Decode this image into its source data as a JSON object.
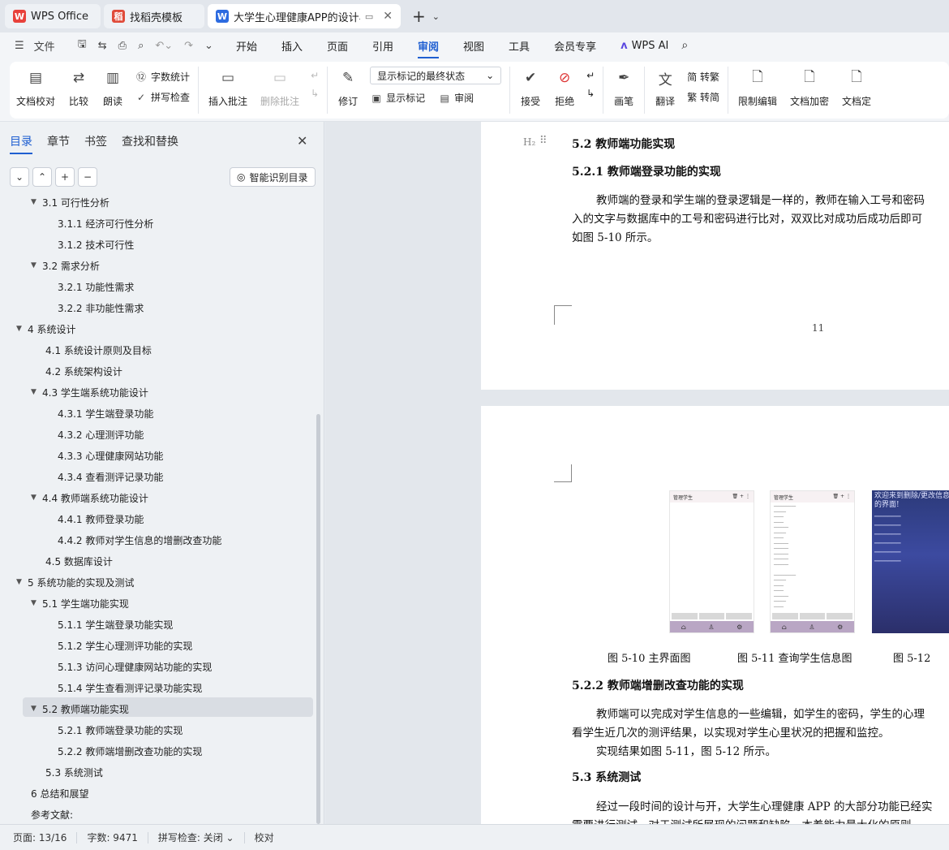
{
  "tabs": [
    {
      "label": "WPS Office",
      "logo": "W",
      "color": "#e8413b",
      "state": "inactive"
    },
    {
      "label": "找稻壳模板",
      "logo": "稻",
      "color": "#e04b3a",
      "state": "inactive"
    },
    {
      "label": "大学生心理健康APP的设计与实",
      "logo": "W",
      "color": "#2d6be0",
      "state": "active"
    }
  ],
  "menubar": {
    "file": "文件",
    "items": [
      "开始",
      "插入",
      "页面",
      "引用",
      "审阅",
      "视图",
      "工具",
      "会员专享"
    ],
    "active": "审阅",
    "wps_ai": "WPS AI"
  },
  "ribbon": {
    "doc_proofread": "文档校对",
    "compare": "比较",
    "read_aloud": "朗读",
    "word_count": "字数统计",
    "spell_check": "拼写检查",
    "insert_comment": "插入批注",
    "delete_comment": "删除批注",
    "revise": "修订",
    "markup_display": "显示标记的最终状态",
    "show_markup": "显示标记",
    "review": "审阅",
    "accept": "接受",
    "reject": "拒绝",
    "pen": "画笔",
    "translate": "翻译",
    "to_traditional": "简 转繁",
    "to_simplified": "繁 转简",
    "restrict_edit": "限制编辑",
    "encrypt": "文档加密",
    "finalize": "文档定"
  },
  "panel": {
    "tabs": [
      "目录",
      "章节",
      "书签",
      "查找和替换"
    ],
    "active_tab": "目录",
    "smart_toc": "智能识别目录",
    "toc": [
      {
        "label": "3.1 可行性分析",
        "level": 2,
        "arrow": "▼"
      },
      {
        "label": "3.1.1 经济可行性分析",
        "level": 3,
        "arrow": ""
      },
      {
        "label": "3.1.2 技术可行性",
        "level": 3,
        "arrow": ""
      },
      {
        "label": "3.2 需求分析",
        "level": 2,
        "arrow": "▼"
      },
      {
        "label": "3.2.1 功能性需求",
        "level": 3,
        "arrow": ""
      },
      {
        "label": "3.2.2  非功能性需求",
        "level": 3,
        "arrow": ""
      },
      {
        "label": "4 系统设计",
        "level": 1,
        "arrow": "▼"
      },
      {
        "label": "4.1 系统设计原则及目标",
        "level": 2,
        "arrow": ""
      },
      {
        "label": "4.2  系统架构设计",
        "level": 2,
        "arrow": ""
      },
      {
        "label": "4.3 学生端系统功能设计",
        "level": 2,
        "arrow": "▼"
      },
      {
        "label": "4.3.1 学生端登录功能",
        "level": 3,
        "arrow": ""
      },
      {
        "label": "4.3.2 心理测评功能",
        "level": 3,
        "arrow": ""
      },
      {
        "label": "4.3.3 心理健康网站功能",
        "level": 3,
        "arrow": ""
      },
      {
        "label": "4.3.4  查看测评记录功能",
        "level": 3,
        "arrow": ""
      },
      {
        "label": "4.4 教师端系统功能设计",
        "level": 2,
        "arrow": "▼"
      },
      {
        "label": "4.4.1 教师登录功能",
        "level": 3,
        "arrow": ""
      },
      {
        "label": "4.4.2 教师对学生信息的增删改查功能",
        "level": 3,
        "arrow": ""
      },
      {
        "label": "4.5  数据库设计",
        "level": 2,
        "arrow": ""
      },
      {
        "label": "5 系统功能的实现及测试",
        "level": 1,
        "arrow": "▼"
      },
      {
        "label": "5.1 学生端功能实现",
        "level": 2,
        "arrow": "▼"
      },
      {
        "label": "5.1.1 学生端登录功能实现",
        "level": 3,
        "arrow": ""
      },
      {
        "label": "5.1.2 学生心理测评功能的实现",
        "level": 3,
        "arrow": ""
      },
      {
        "label": "5.1.3 访问心理健康网站功能的实现",
        "level": 3,
        "arrow": ""
      },
      {
        "label": "5.1.4 学生查看测评记录功能实现",
        "level": 3,
        "arrow": ""
      },
      {
        "label": "5.2 教师端功能实现",
        "level": 2,
        "arrow": "▼",
        "selected": true
      },
      {
        "label": "5.2.1 教师端登录功能的实现",
        "level": 3,
        "arrow": ""
      },
      {
        "label": "5.2.2  教师端增删改查功能的实现",
        "level": 3,
        "arrow": ""
      },
      {
        "label": "5.3 系统测试",
        "level": 2,
        "arrow": ""
      },
      {
        "label": "6 总结和展望",
        "level": 1,
        "arrow": ""
      },
      {
        "label": "参考文献:",
        "level": 1,
        "arrow": ""
      }
    ]
  },
  "doc": {
    "h_52": "5.2 教师端功能实现",
    "h_521": "5.2.1 教师端登录功能的实现",
    "p1_l1": "教师端的登录和学生端的登录逻辑是一样的，教师在输入工号和密码",
    "p1_l2": "入的文字与数据库中的工号和密码进行比对，双双比对成功后成功后即可",
    "p1_l3": "如图 5-10 所示。",
    "page_number": "11",
    "h2_marker": "H₂",
    "phone1_title": "管理学生",
    "phone2_title": "管理学生",
    "phone3_text": "欢迎来到删除/更改信息的界面!",
    "fig_5_10": "图  5-10  主界面图",
    "fig_5_11": "图 5-11  查询学生信息图",
    "fig_5_12": "图  5-12",
    "h_522": "5.2.2  教师端增删改查功能的实现",
    "p2_l1": "教师端可以完成对学生信息的一些编辑，如学生的密码，学生的心理",
    "p2_l2": "看学生近几次的测评结果，以实现对学生心里状况的把握和监控。",
    "p2_l3": "实现结果如图 5-11，图 5-12 所示。",
    "h_53": "5.3 系统测试",
    "p3_l1": "经过一段时间的设计与开，大学生心理健康 APP 的大部分功能已经实",
    "p3_l2": "需要进行测试，对于测试所展现的问题和缺陷，本着能力最大化的原则，"
  },
  "status": {
    "page": "页面: 13/16",
    "words": "字数: 9471",
    "spell": "拼写检查: 关闭",
    "proof": "校对"
  }
}
